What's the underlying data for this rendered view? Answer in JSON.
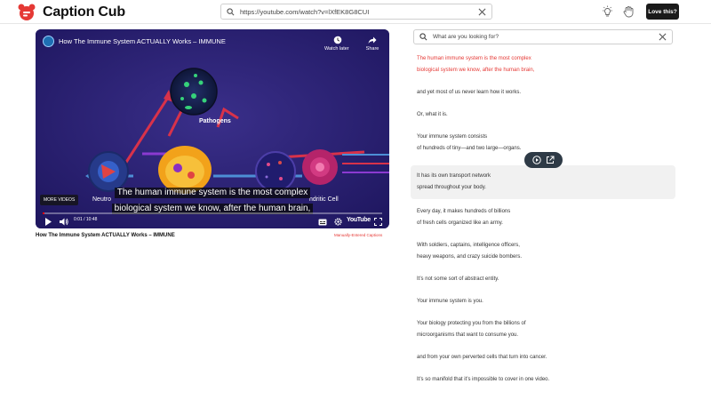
{
  "app": {
    "name": "Caption Cub",
    "brand_color": "#e53935",
    "url": "https://youtube.com/watch?v=lXfEK8G8CUI",
    "love_label": "Love this?"
  },
  "video": {
    "overlay_title": "How The Immune System ACTUALLY Works – IMMUNE",
    "watch_later": "Watch later",
    "share": "Share",
    "scene_label_pathogens": "Pathogens",
    "scene_label_neutro": "Neutro",
    "scene_label_dendritic": "ndritic Cell",
    "subtitle_line1": "The human immune system is the most complex",
    "subtitle_line2": "biological system we know, after the human brain,",
    "more_videos": "MORE VIDEOS",
    "time": "0:01 / 10:48",
    "progress": 0.002,
    "platform": "YouTube",
    "title_below": "How The Immune System ACTUALLY Works – IMMUNE",
    "caption_type": "Manually-Entered Captions"
  },
  "search": {
    "placeholder": "What are you looking for?"
  },
  "captions": [
    {
      "lines": [
        "The human immune system is the most complex",
        "biological system we know, after the human brain,"
      ]
    },
    {
      "lines": [
        "and yet most of us never learn how it works."
      ]
    },
    {
      "lines": [
        "Or, what it is."
      ]
    },
    {
      "lines": [
        "Your immune system consists",
        "of hundreds of tiny—and two large—organs."
      ]
    },
    {
      "lines": [
        "It has its own transport network",
        "spread throughout your body."
      ]
    },
    {
      "lines": [
        "Every day, it makes hundreds of billions",
        "of fresh cells organized like an army."
      ]
    },
    {
      "lines": [
        "With soldiers, captains, intelligence officers,",
        "heavy weapons, and crazy suicide bombers."
      ]
    },
    {
      "lines": [
        "It’s not some sort of abstract entity."
      ]
    },
    {
      "lines": [
        "Your immune system is you."
      ]
    },
    {
      "lines": [
        "Your biology protecting you from the billions of",
        "microorganisms that want to consume you."
      ]
    },
    {
      "lines": [
        "and from your own perverted cells that turn into cancer."
      ]
    },
    {
      "lines": [
        "It’s so manifold that it’s impossible to cover in one video."
      ]
    }
  ]
}
